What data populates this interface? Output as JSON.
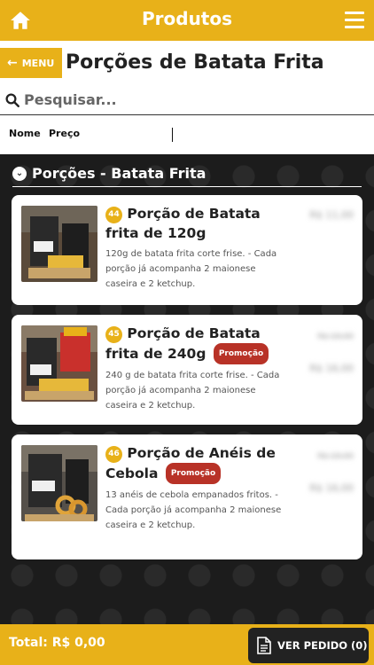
{
  "header": {
    "title": "Produtos",
    "home_icon": "home-icon",
    "menu_icon": "hamburger-menu-icon"
  },
  "nav": {
    "back_label": "MENU",
    "back_icon": "arrow-left-icon",
    "page_title": "Porções de Batata Frita"
  },
  "search": {
    "placeholder": "Pesquisar...",
    "value": ""
  },
  "sort": {
    "name_label": "Nome",
    "price_label": "Preço"
  },
  "section": {
    "title": "Porções - Batata Frita",
    "icon": "chevron-circle-down-icon"
  },
  "products": [
    {
      "number": "44",
      "name": "Porção de Batata frita de 120g",
      "promo": "",
      "description": "120g de batata frita corte frise. - Cada porção já acompanha 2 maionese caseira e 2 ketchup.",
      "price": "R$ 11,00",
      "old_price": ""
    },
    {
      "number": "45",
      "name": "Porção de Batata frita de 240g",
      "promo": "Promoção",
      "description": "240 g de batata frita corte frise. - Cada porção já acompanha 2 maionese caseira e 2 ketchup.",
      "price": "R$ 16,00",
      "old_price": "R$ 19,00"
    },
    {
      "number": "46",
      "name": "Porção de Anéis de Cebola",
      "promo": "Promoção",
      "description": "13 anéis de cebola empanados fritos. - Cada porção já acompanha 2 maionese caseira e 2 ketchup.",
      "price": "R$ 16,00",
      "old_price": "R$ 19,00"
    }
  ],
  "footer": {
    "total_label": "Total: R$ 0,00",
    "order_button": "VER PEDIDO (0)",
    "order_icon": "document-icon"
  },
  "colors": {
    "accent": "#e8b119",
    "promo": "#b83227",
    "background": "#1c1c1c"
  }
}
